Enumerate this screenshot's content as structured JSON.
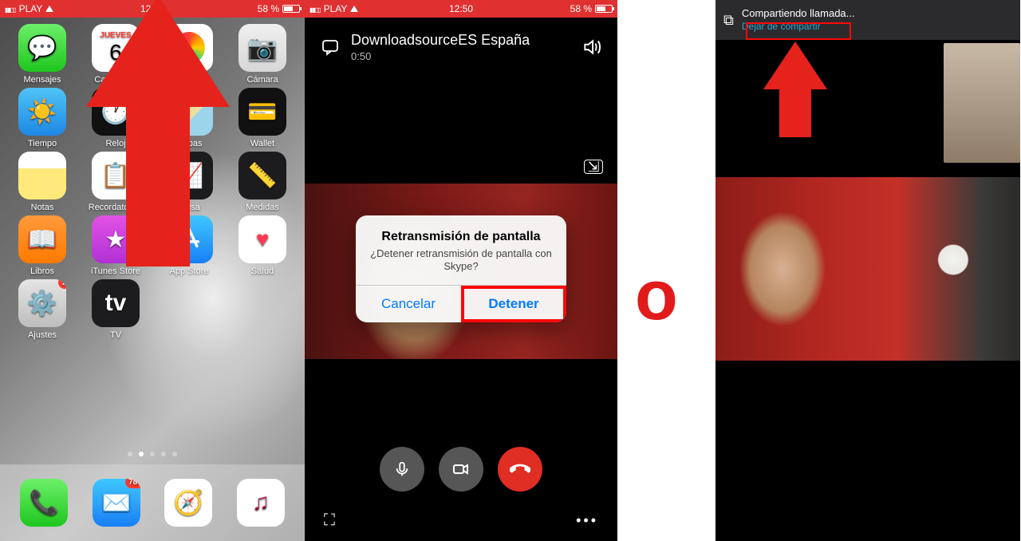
{
  "phone1": {
    "status": {
      "carrier": "PLAY",
      "time": "12:52",
      "battery": "58 %"
    },
    "apps": {
      "row1": [
        {
          "key": "mensajes",
          "label": "Mensajes"
        },
        {
          "key": "calendario",
          "label": "Calendario",
          "dow": "Jueves",
          "dnum": "6"
        },
        {
          "key": "fotos",
          "label": "Fotos"
        },
        {
          "key": "camara",
          "label": "Cámara"
        }
      ],
      "row2": [
        {
          "key": "tiempo",
          "label": "Tiempo"
        },
        {
          "key": "reloj",
          "label": "Reloj"
        },
        {
          "key": "mapas",
          "label": "Mapas"
        },
        {
          "key": "wallet",
          "label": "Wallet"
        }
      ],
      "row3": [
        {
          "key": "notas",
          "label": "Notas"
        },
        {
          "key": "record",
          "label": "Recordatorios"
        },
        {
          "key": "bolsa",
          "label": "Bolsa"
        },
        {
          "key": "medidas",
          "label": "Medidas"
        }
      ],
      "row4": [
        {
          "key": "libros",
          "label": "Libros"
        },
        {
          "key": "itunes",
          "label": "iTunes Store"
        },
        {
          "key": "appstore",
          "label": "App Store"
        },
        {
          "key": "salud",
          "label": "Salud"
        }
      ],
      "row5": [
        {
          "key": "ajustes",
          "label": "Ajustes",
          "badge": "2"
        },
        {
          "key": "tv",
          "label": "TV"
        }
      ]
    },
    "dock": [
      {
        "key": "phone",
        "label": "Teléfono"
      },
      {
        "key": "mail",
        "label": "Mail",
        "badge": "789"
      },
      {
        "key": "safari",
        "label": "Safari"
      },
      {
        "key": "music",
        "label": "Música"
      }
    ]
  },
  "phone2": {
    "status": {
      "carrier": "PLAY",
      "time": "12:50",
      "battery": "58 %"
    },
    "call": {
      "title": "DownloadsourceES España",
      "elapsed": "0:50"
    },
    "dialog": {
      "title": "Retransmisión de pantalla",
      "message": "¿Detener retransmisión de pantalla con Skype?",
      "cancel": "Cancelar",
      "confirm": "Detener"
    }
  },
  "separator": "o",
  "phone3": {
    "share": {
      "title": "Compartiendo llamada...",
      "stop_link": "Dejar de compartir"
    }
  }
}
